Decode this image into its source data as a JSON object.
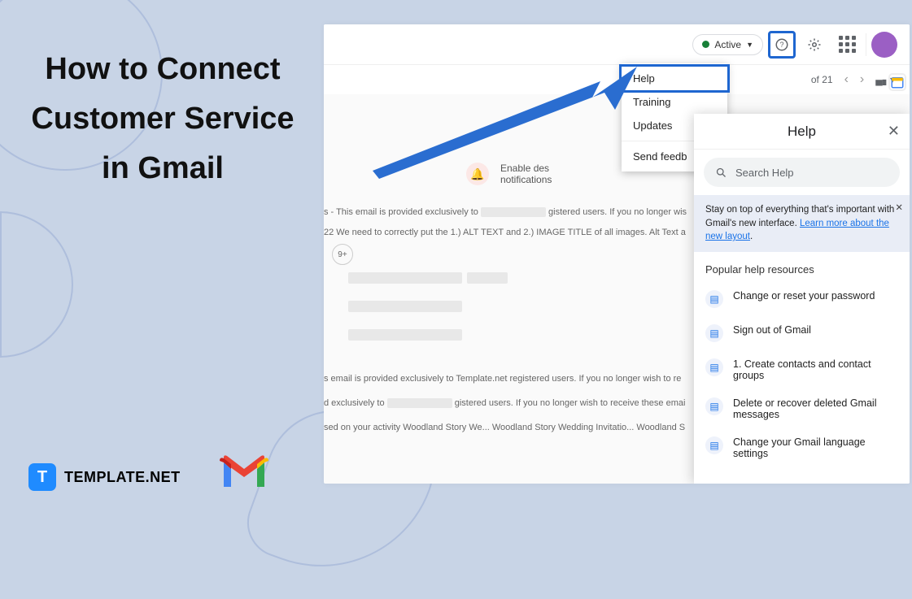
{
  "title_lines": "How to Connect Customer Service in Gmail",
  "brand": {
    "icon_letter": "T",
    "name": "TEMPLATE.NET"
  },
  "topbar": {
    "active_label": "Active",
    "pagination": "of 21"
  },
  "dropdown": {
    "help": "Help",
    "training": "Training",
    "updates": "Updates",
    "feedback": "Send feedb"
  },
  "notification": {
    "line1": "Enable des",
    "line2": "notifications"
  },
  "emails": {
    "l1_a": "s - This email is provided exclusively to",
    "l1_b": "gistered users. If you no longer wis",
    "l2": "22 We need to correctly put the 1.) ALT TEXT and 2.) IMAGE TITLE of all images. Alt Text a",
    "plus9": "9+",
    "l3": "s email is provided exclusively to Template.net registered users. If you no longer wish to re",
    "l4_a": "d exclusively to",
    "l4_b": "gistered users. If you no longer wish to receive these emai",
    "l5": "sed on your activity Woodland Story We... Woodland Story Wedding Invitatio... Woodland S"
  },
  "help_panel": {
    "title": "Help",
    "search_placeholder": "Search Help",
    "banner_text": "Stay on top of everything that's important with Gmail's new interface. ",
    "banner_link": "Learn more about the new layout",
    "section": "Popular help resources",
    "items": [
      "Change or reset your password",
      "Sign out of Gmail",
      "1. Create contacts and contact groups",
      "Delete or recover deleted Gmail messages",
      "Change your Gmail language settings"
    ]
  }
}
